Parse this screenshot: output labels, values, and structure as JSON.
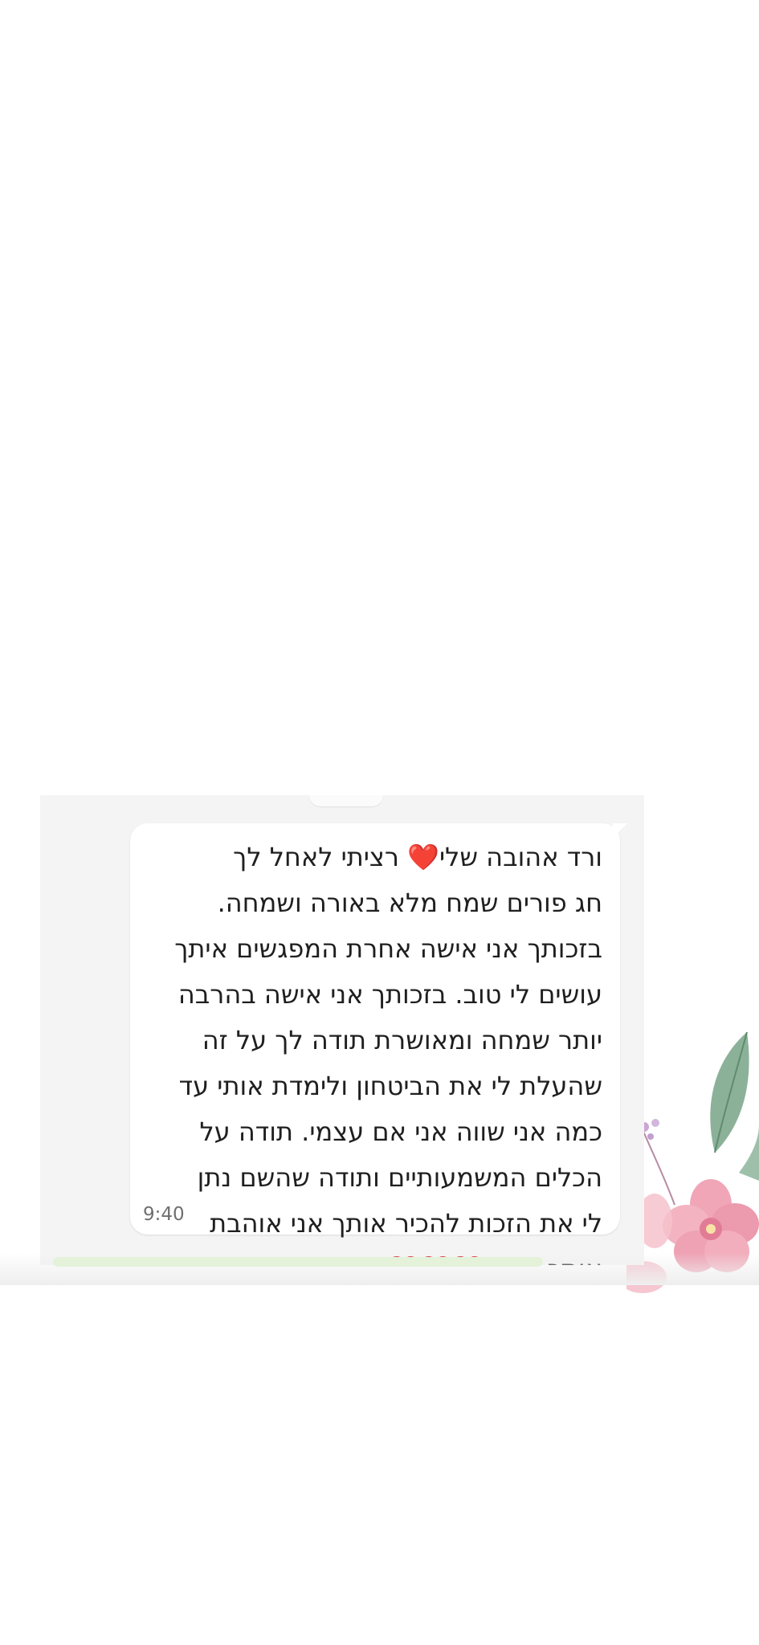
{
  "message": {
    "text": "ורד אהובה שלי❤️ רציתי לאחל לך\nחג פורים שמח מלא באורה ושמחה.\nבזכותך אני אישה אחרת המפגשים איתך\nעושים לי טוב. בזכותך אני אישה בהרבה\nיותר שמחה ומאושרת תודה לך על זה\nשהעלת לי את הביטחון ולימדת אותי עד\nכמה אני שווה אני אם עצמי. תודה על\nהכלים המשמעותיים ותודה שהשם נתן\nלי את הזכות להכיר אותך אני אוהבת\nאותך מאוד❤️❤️❤️😘",
    "time": "9:40"
  },
  "colors": {
    "page_background": "#ffffff",
    "chat_background": "#f4f4f4",
    "bubble_background": "#ffffff",
    "text": "#1f1f1f",
    "timestamp": "#6f6f6f",
    "flower_pink": "#f0a6b6",
    "leaf_green": "#7fa88e"
  },
  "icons": [
    "flower-decoration"
  ]
}
